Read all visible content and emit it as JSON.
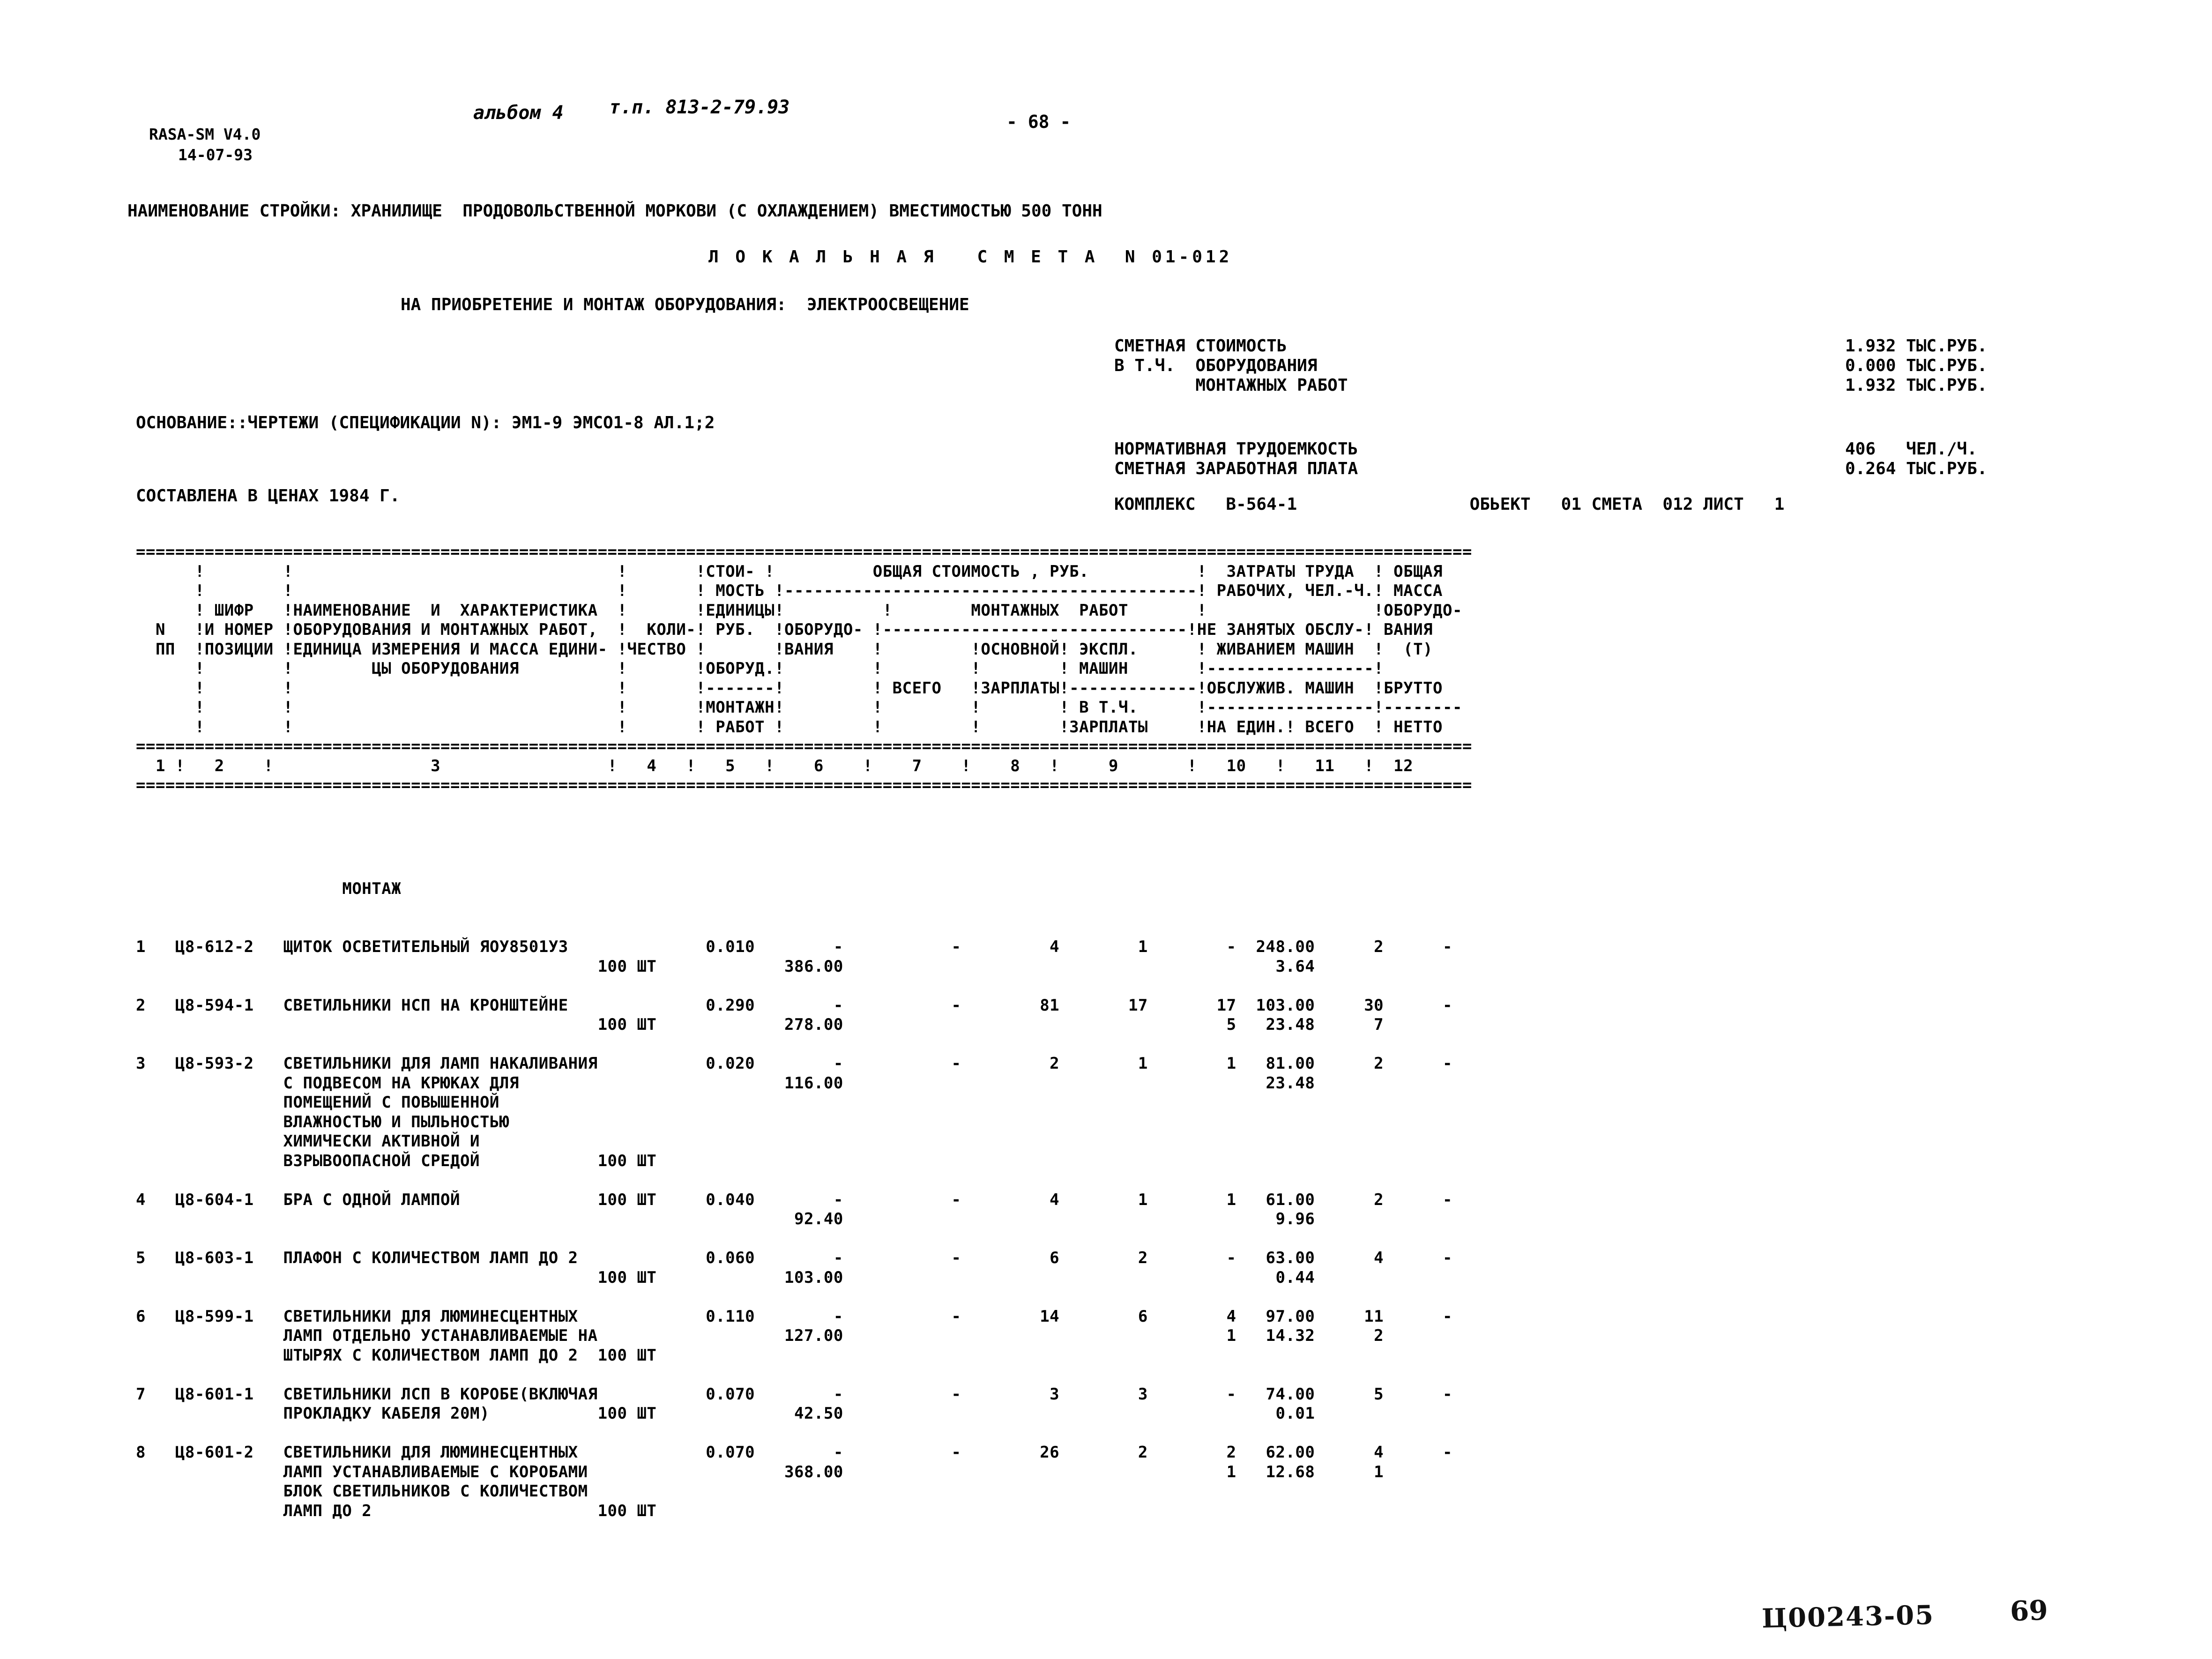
{
  "document": {
    "program_line1": "RASA-SM V4.0",
    "program_line2": "14-07-93",
    "album": "альбом 4",
    "type_project": "т.п. 813-2-79.93",
    "page_marker": "- 68 -",
    "construction_name_label": "НАИМЕНОВАНИЕ СТРОЙКИ:",
    "construction_name": "ХРАНИЛИЩЕ  ПРОДОВОЛЬСТВЕННОЙ МОРКОВИ (С ОХЛАЖДЕНИЕМ) ВМЕСТИМОСТЬЮ 500 ТОНН",
    "construction_full_line": "НАИМЕНОВАНИЕ СТРОЙКИ: ХРАНИЛИЩЕ  ПРОДОВОЛЬСТВЕННОЙ МОРКОВИ (С ОХЛАЖДЕНИЕМ) ВМЕСТИМОСТЬЮ 500 ТОНН",
    "estimate_title": "Л О К А Л Ь Н А Я   С М Е Т А  N 01-012",
    "estimate_subtitle": "НА ПРИОБРЕТЕНИЕ И МОНТАЖ ОБОРУДОВАНИЯ:  ЭЛЕКТРООСВЕЩЕНИЕ",
    "basis_line": "ОСНОВАНИЕ::ЧЕРТЕЖИ (СПЕЦИФИКАЦИИ N): ЭМ1-9 ЭМСО1-8 АЛ.1;2",
    "prices_line": "СОСТАВЛЕНА В ЦЕНАХ 1984 Г.",
    "complex_line": "КОМПЛЕКС   B-564-1                 ОБЬЕКТ   01 СМЕТА  012 ЛИСТ   1",
    "complex_label": "КОМПЛЕКС",
    "complex_value": "B-564-1",
    "object_label": "ОБЬЕКТ",
    "object_value": "01",
    "smeta_label": "СМЕТА",
    "smeta_value": "012",
    "sheet_label": "ЛИСТ",
    "sheet_value": "1",
    "stamp_code": "Ц00243-05",
    "stamp_page": "69"
  },
  "summary": {
    "rows": [
      {
        "label": "СМЕТНАЯ СТОИМОСТЬ",
        "value": "1.932 ТЫС.РУБ."
      },
      {
        "label": "В Т.Ч.  ОБОРУДОВАНИЯ",
        "value": "0.000 ТЫС.РУБ."
      },
      {
        "label": "        МОНТАЖНЫХ РАБОТ",
        "value": "1.932 ТЫС.РУБ."
      }
    ],
    "rows2": [
      {
        "label": "НОРМАТИВНАЯ ТРУДОЕМКОСТЬ",
        "value": "406   ЧЕЛ./Ч."
      },
      {
        "label": "СМЕТНАЯ ЗАРАБОТНАЯ ПЛАТА",
        "value": "0.264 ТЫС.РУБ."
      }
    ],
    "labels_block": "СМЕТНАЯ СТОИМОСТЬ\nВ Т.Ч.  ОБОРУДОВАНИЯ\n        МОНТАЖНЫХ РАБОТ",
    "values_block": "1.932 ТЫС.РУБ.\n0.000 ТЫС.РУБ.\n1.932 ТЫС.РУБ.",
    "labels_block2": "НОРМАТИВНАЯ ТРУДОЕМКОСТЬ\nСМЕТНАЯ ЗАРАБОТНАЯ ПЛАТА",
    "values_block2": "406   ЧЕЛ./Ч.\n0.264 ТЫС.РУБ."
  },
  "table": {
    "header_ascii": "==================================================================================================================================\n      !        !                             !       !СТОИ- !          ОБЩАЯ СТОИМОСТЬ , РУБ.          ! ЗАТРАТЫ ТРУДА  ! ОБЩАЯ\n      !        !                             !       ! МОСТЬ !-----------------------------------------! РАБОЧИХ, ЧЕЛ.-Ч.! МАССА\n      ! ШИФР   !НАИМЕНОВАНИЕ  И  ХАРАКТЕРИСТИКА !      !ЕДИНИЦЫ!           !         МОНТАЖНЫХ  РАБОТ   !                 !ОБОРУДО-\n  N   !И НОМЕР !ОБОРУДОВАНИЯ И МОНТАЖНЫХ РАБОТ, !  КОЛИ-! РУБ. !ОБОРУДО-!------------------------------!НЕ ЗАНЯТЫХ ОБСЛУ-! ВАНИЯ\n  ПП  !ПОЗИЦИИ !ЕДИНИЦА ИЗМЕРЕНИЯ И МАССА ЕДИНИ-!ЧЕСТВО !      !ВАНИЯ   !        !ОСНОВНОЙ! ЭКСПЛ.      ! ЖИВАНИЕМ МАШИН  !  (Т)\n      !        !      ЦЫ ОБОРУДОВАНИЯ           !       !ОБОРУД.!        ! ВСЕГО  !ЗАРПЛАТЫ! МАШИН      !-----------------!\n      !        !                                !       !-------!        !        !        ! В Т.Ч.     !ОБСЛУЖИВ. МАШИН  !БРУТТО\n      !        !                                !       !МОНТАЖН!        !        !        !ЗАРПЛАТЫ    !-----------------!--------\n      !        !                                !       ! РАБОТ !        !        !        !            !НА ЕДИН.! ВСЕГО  ! НЕТТО\n==================================================================================================================================\n  1 !   2    !              3                 !   4   !  5   !   6    !   7    !   8    !    9       !   10   !   11   !  12\n==================================================================================================================================",
    "col_numbers": [
      "1",
      "2",
      "3",
      "4",
      "5",
      "6",
      "7",
      "8",
      "9",
      "10",
      "11",
      "12"
    ],
    "section_label": "МОНТАЖ",
    "rows": [
      {
        "n": "1",
        "code": "Ц8-612-2",
        "description": [
          "ЩИТОК ОСВЕТИТЕЛЬНЫЙ ЯОУ8501У3"
        ],
        "unit": "100 ШТ",
        "quantity": "0.010",
        "unit_cost_equip": "-",
        "unit_cost_install": "386.00",
        "total_equip": "-",
        "total_all": "4",
        "total_basic_wage": "1",
        "machine_oper": "-",
        "machine_wage": "",
        "labor_per_unit": "248.00",
        "labor_machine_unit": "3.64",
        "labor_total": "2",
        "labor_total2": "",
        "mass": "-"
      },
      {
        "n": "2",
        "code": "Ц8-594-1",
        "description": [
          "СВЕТИЛЬНИКИ НСП НА КРОНШТЕЙНЕ"
        ],
        "unit": "100 ШТ",
        "quantity": "0.290",
        "unit_cost_equip": "-",
        "unit_cost_install": "278.00",
        "total_equip": "-",
        "total_all": "81",
        "total_basic_wage": "17",
        "machine_oper": "17",
        "machine_wage": "5",
        "labor_per_unit": "103.00",
        "labor_machine_unit": "23.48",
        "labor_total": "30",
        "labor_total2": "7",
        "mass": "-"
      },
      {
        "n": "3",
        "code": "Ц8-593-2",
        "description": [
          "СВЕТИЛЬНИКИ ДЛЯ ЛАМП НАКАЛИВАНИЯ",
          "С ПОДВЕСОМ НА КРЮКАХ ДЛЯ",
          "ПОМЕЩЕНИЙ С ПОВЫШЕННОЙ",
          "ВЛАЖНОСТЬЮ И ПЫЛЬНОСТЬЮ",
          "ХИМИЧЕСКИ АКТИВНОЙ И",
          "ВЗРЫВООПАСНОЙ СРЕДОЙ"
        ],
        "unit": "100 ШТ",
        "quantity": "0.020",
        "unit_cost_equip": "-",
        "unit_cost_install": "116.00",
        "total_equip": "-",
        "total_all": "2",
        "total_basic_wage": "1",
        "machine_oper": "1",
        "machine_wage": "",
        "labor_per_unit": "81.00",
        "labor_machine_unit": "23.48",
        "labor_total": "2",
        "labor_total2": "",
        "mass": "-"
      },
      {
        "n": "4",
        "code": "Ц8-604-1",
        "description": [
          "БРА С ОДНОЙ ЛАМПОЙ"
        ],
        "unit": "100 ШТ",
        "unit_inline": true,
        "quantity": "0.040",
        "unit_cost_equip": "-",
        "unit_cost_install": "92.40",
        "total_equip": "-",
        "total_all": "4",
        "total_basic_wage": "1",
        "machine_oper": "1",
        "machine_wage": "",
        "labor_per_unit": "61.00",
        "labor_machine_unit": "9.96",
        "labor_total": "2",
        "labor_total2": "",
        "mass": "-"
      },
      {
        "n": "5",
        "code": "Ц8-603-1",
        "description": [
          "ПЛАФОН С КОЛИЧЕСТВОМ ЛАМП ДО 2"
        ],
        "unit": "100 ШТ",
        "quantity": "0.060",
        "unit_cost_equip": "-",
        "unit_cost_install": "103.00",
        "total_equip": "-",
        "total_all": "6",
        "total_basic_wage": "2",
        "machine_oper": "-",
        "machine_wage": "",
        "labor_per_unit": "63.00",
        "labor_machine_unit": "0.44",
        "labor_total": "4",
        "labor_total2": "",
        "mass": "-"
      },
      {
        "n": "6",
        "code": "Ц8-599-1",
        "description": [
          "СВЕТИЛЬНИКИ ДЛЯ ЛЮМИНЕСЦЕНТНЫХ",
          "ЛАМП ОТДЕЛЬНО УСТАНАВЛИВАЕМЫЕ НА",
          "ШТЫРЯХ С КОЛИЧЕСТВОМ ЛАМП ДО 2"
        ],
        "unit": "100 ШТ",
        "quantity": "0.110",
        "unit_cost_equip": "-",
        "unit_cost_install": "127.00",
        "total_equip": "-",
        "total_all": "14",
        "total_basic_wage": "6",
        "machine_oper": "4",
        "machine_wage": "1",
        "labor_per_unit": "97.00",
        "labor_machine_unit": "14.32",
        "labor_total": "11",
        "labor_total2": "2",
        "mass": "-"
      },
      {
        "n": "7",
        "code": "Ц8-601-1",
        "description": [
          "СВЕТИЛЬНИКИ ЛСП В КОРОБЕ(ВКЛЮЧАЯ",
          "ПРОКЛАДКУ КАБЕЛЯ 20М)"
        ],
        "unit": "100 ШТ",
        "quantity": "0.070",
        "unit_cost_equip": "-",
        "unit_cost_install": "42.50",
        "total_equip": "-",
        "total_all": "3",
        "total_basic_wage": "3",
        "machine_oper": "-",
        "machine_wage": "",
        "labor_per_unit": "74.00",
        "labor_machine_unit": "0.01",
        "labor_total": "5",
        "labor_total2": "",
        "mass": "-"
      },
      {
        "n": "8",
        "code": "Ц8-601-2",
        "description": [
          "СВЕТИЛЬНИКИ ДЛЯ ЛЮМИНЕСЦЕНТНЫХ",
          "ЛАМП УСТАНАВЛИВАЕМЫЕ С КОРОБАМИ",
          "БЛОК СВЕТИЛЬНИКОВ С КОЛИЧЕСТВОМ",
          "ЛАМП ДО 2"
        ],
        "unit": "100 ШТ",
        "quantity": "0.070",
        "unit_cost_equip": "-",
        "unit_cost_install": "368.00",
        "total_equip": "-",
        "total_all": "26",
        "total_basic_wage": "2",
        "machine_oper": "2",
        "machine_wage": "1",
        "labor_per_unit": "62.00",
        "labor_machine_unit": "12.68",
        "labor_total": "4",
        "labor_total2": "1",
        "mass": "-"
      }
    ]
  },
  "rendered": {
    "header_block": "      !        !                              !       !СТОИ- !           ОБЩАЯ СТОИМОСТЬ , РУБ.          !  ЗАТРАТЫ ТРУДА  ! ОБЩАЯ\n      !        !                              !       ! МОСТЬ !-------------------------------------------! РАБОЧИХ, ЧЕЛ.-Ч.! МАССА\n      ! ШИФР   !НАИМЕНОВАНИЕ  И  ХАРАКТЕРИСТИКА!       !ЕДИНИЦЫ!          !       МОНТАЖНЫХ  РАБОТ        !                 !ОБОРУДО-\n  N   !И НОМЕР !ОБОРУДОВАНИЯ И МОНТАЖНЫХ РАБОТ,!  КОЛИ-! РУБ.  !ОБОРУДО- !-------------------------------!НЕ ЗАНЯТЫХ ОБСЛУ-! ВАНИЯ\n  ПП  !ПОЗИЦИИ !ЕДИНИЦА ИЗМЕРЕНИЯ И МАССА ЕДИНИ-!ЧЕСТВО !       !ВАНИЯ    !         !ОСНОВНОЙ! ЭКСПЛ.     ! ЖИВАНИЕМ МАШИН  !  (Т)\n      !        !       ЦЫ ОБОРУДОВАНИЯ         !       !ОБОРУД.!         !         !        ! МАШИН      !-----------------!\n      !        !                              !       !-------!         ! ВСЕГО   !ЗАРПЛАТЫ!------------!ОБСЛУЖИВ. МАШИН  !БРУТТО\n      !        !                              !       !МОНТАЖН!         !         !        ! В Т.Ч.     !-----------------!--------\n      !        !                              !       ! РАБОТ !         !         !        !ЗАРПЛАТЫ    !НА ЕДИН.! ВСЕГО  ! НЕТТО"
  }
}
